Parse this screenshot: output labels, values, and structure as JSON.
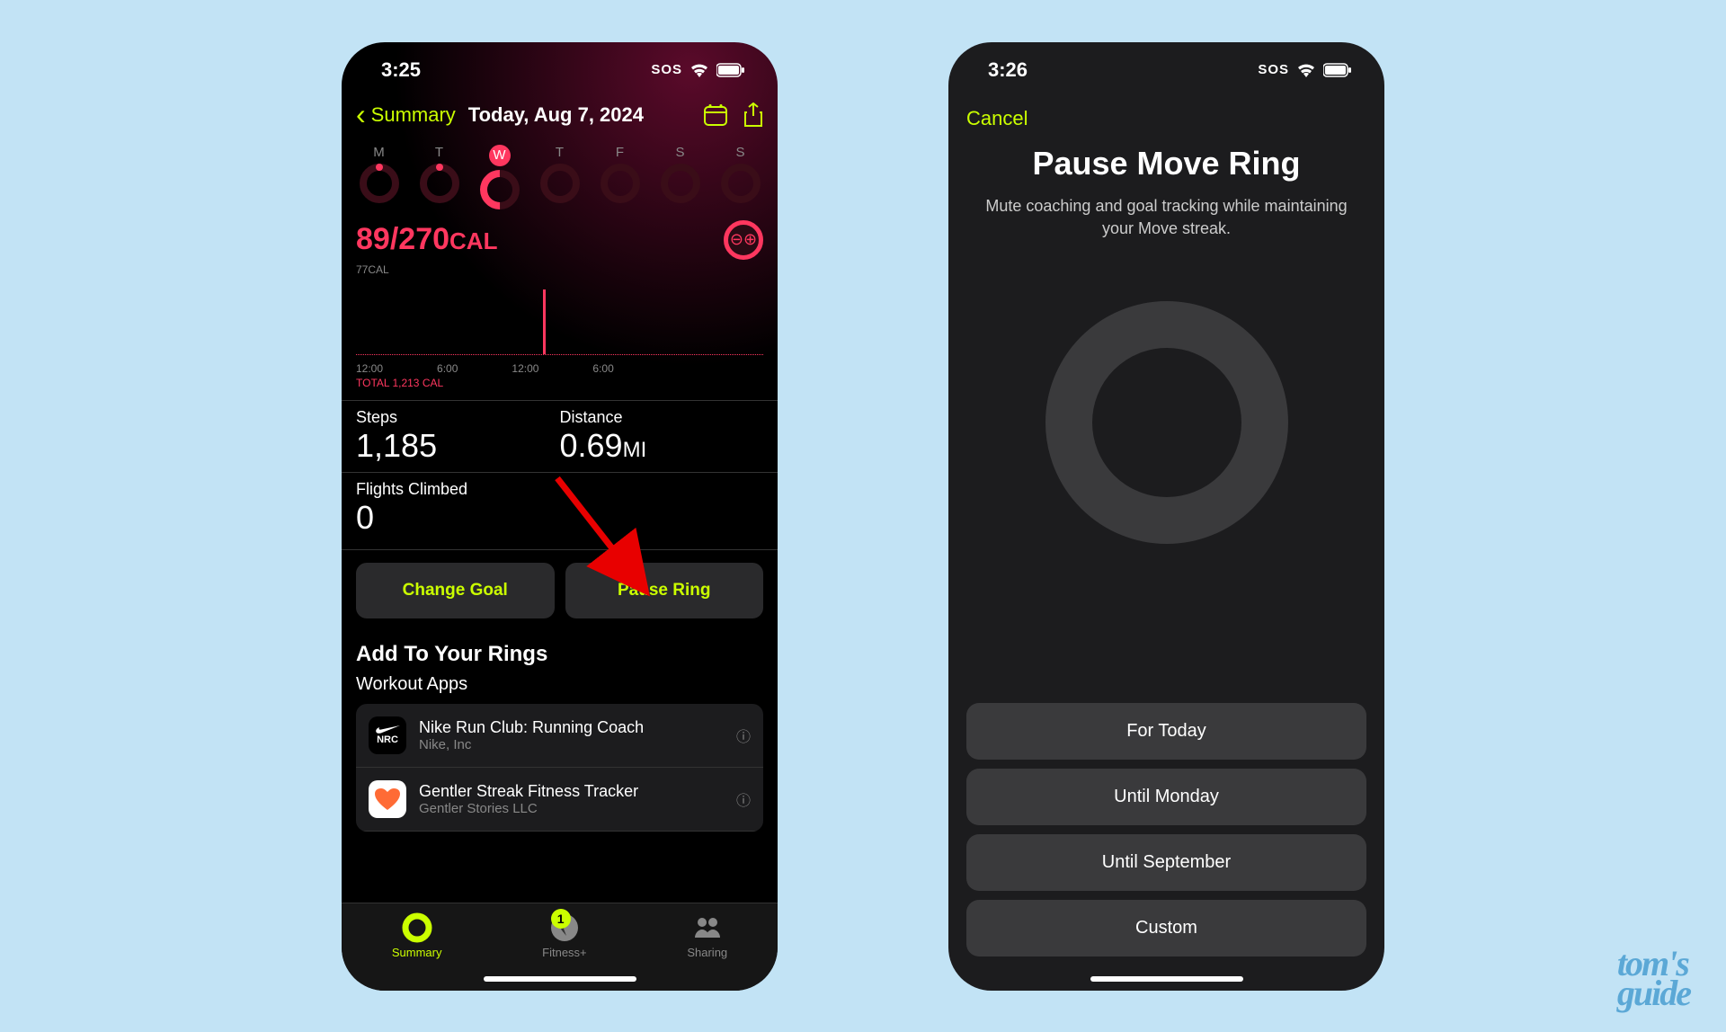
{
  "left": {
    "status": {
      "time": "3:25",
      "sos": "SOS"
    },
    "nav": {
      "back_label": "Summary",
      "date": "Today, Aug 7, 2024"
    },
    "days": [
      "M",
      "T",
      "W",
      "T",
      "F",
      "S",
      "S"
    ],
    "active_day_index": 2,
    "move": {
      "current": "89",
      "goal": "270",
      "unit": "CAL"
    },
    "chart": {
      "y_label": "77CAL",
      "times": [
        "12:00",
        "6:00",
        "12:00",
        "6:00"
      ],
      "total": "TOTAL 1,213 CAL"
    },
    "stats": {
      "steps_label": "Steps",
      "steps_value": "1,185",
      "distance_label": "Distance",
      "distance_value": "0.69",
      "distance_unit": "MI",
      "flights_label": "Flights Climbed",
      "flights_value": "0"
    },
    "buttons": {
      "change_goal": "Change Goal",
      "pause_ring": "Pause Ring"
    },
    "add_section": {
      "title": "Add To Your Rings",
      "subtitle": "Workout Apps"
    },
    "apps": [
      {
        "name": "Nike Run Club: Running Coach",
        "dev": "Nike, Inc"
      },
      {
        "name": "Gentler Streak Fitness Tracker",
        "dev": "Gentler Stories LLC"
      }
    ],
    "tabs": {
      "summary": "Summary",
      "fitness": "Fitness+",
      "sharing": "Sharing",
      "badge": "1"
    }
  },
  "right": {
    "status": {
      "time": "3:26",
      "sos": "SOS"
    },
    "cancel": "Cancel",
    "title": "Pause Move Ring",
    "desc": "Mute coaching and goal tracking while maintaining your Move streak.",
    "options": [
      "For Today",
      "Until Monday",
      "Until September",
      "Custom"
    ]
  },
  "watermark": {
    "line1": "tom's",
    "line2": "guide"
  }
}
